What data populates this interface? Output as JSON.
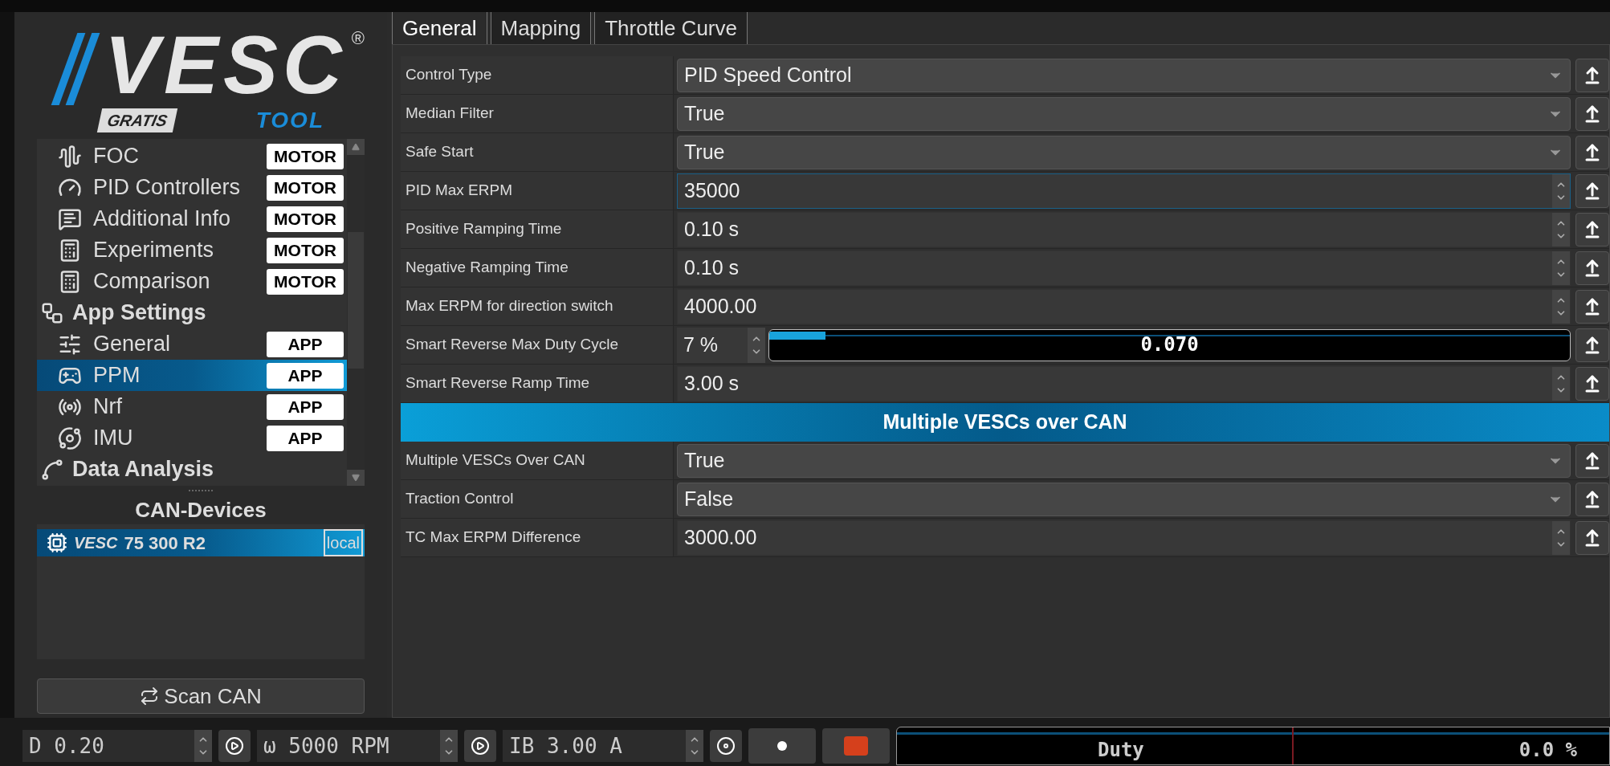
{
  "logo": {
    "wordmark": "VESC",
    "registered": "®",
    "edition": "GRATIS",
    "product": "TOOL"
  },
  "sidebar": {
    "items": [
      {
        "kind": "item",
        "label": "FOC",
        "badge": "MOTOR",
        "selected": false
      },
      {
        "kind": "item",
        "label": "PID Controllers",
        "badge": "MOTOR",
        "selected": false
      },
      {
        "kind": "item",
        "label": "Additional Info",
        "badge": "MOTOR",
        "selected": false
      },
      {
        "kind": "item",
        "label": "Experiments",
        "badge": "MOTOR",
        "selected": false
      },
      {
        "kind": "item",
        "label": "Comparison",
        "badge": "MOTOR",
        "selected": false
      },
      {
        "kind": "section",
        "label": "App Settings"
      },
      {
        "kind": "item",
        "label": "General",
        "badge": "APP",
        "selected": false
      },
      {
        "kind": "item",
        "label": "PPM",
        "badge": "APP",
        "selected": true
      },
      {
        "kind": "item",
        "label": "Nrf",
        "badge": "APP",
        "selected": false
      },
      {
        "kind": "item",
        "label": "IMU",
        "badge": "APP",
        "selected": false
      },
      {
        "kind": "section",
        "label": "Data Analysis"
      }
    ]
  },
  "can_devices": {
    "title": "CAN-Devices",
    "devices": [
      {
        "logo": "VESC",
        "name": "75 300 R2",
        "badge": "local",
        "selected": true
      }
    ],
    "scan_button": "Scan CAN"
  },
  "tabs": [
    {
      "label": "General",
      "selected": true
    },
    {
      "label": "Mapping",
      "selected": false
    },
    {
      "label": "Throttle Curve",
      "selected": false
    }
  ],
  "rows": [
    {
      "kind": "combo",
      "label": "Control Type",
      "value": "PID Speed Control"
    },
    {
      "kind": "combo",
      "label": "Median Filter",
      "value": "True"
    },
    {
      "kind": "combo",
      "label": "Safe Start",
      "value": "True"
    },
    {
      "kind": "spin",
      "label": "PID Max ERPM",
      "value": "35000",
      "focused": true
    },
    {
      "kind": "spin",
      "label": "Positive Ramping Time",
      "value": "0.10 s",
      "focused": false
    },
    {
      "kind": "spin",
      "label": "Negative Ramping Time",
      "value": "0.10 s",
      "focused": false
    },
    {
      "kind": "spin",
      "label": "Max ERPM for direction switch",
      "value": "4000.00",
      "focused": false
    },
    {
      "kind": "slider",
      "label": "Smart Reverse Max Duty Cycle",
      "value": "7 %",
      "level": 0.07,
      "reading": "0.070"
    },
    {
      "kind": "spin",
      "label": "Smart Reverse Ramp Time",
      "value": "3.00 s",
      "focused": false
    },
    {
      "kind": "header",
      "label": "Multiple VESCs over CAN"
    },
    {
      "kind": "combo",
      "label": "Multiple VESCs Over CAN",
      "value": "True"
    },
    {
      "kind": "combo",
      "label": "Traction Control",
      "value": "False"
    },
    {
      "kind": "spin",
      "label": "TC Max ERPM Difference",
      "value": "3000.00",
      "focused": false
    }
  ],
  "bottom_bar": {
    "duty_field": "D 0.20",
    "speed_field": "ω 5000 RPM",
    "current_field": "IB 3.00 A",
    "gauge": {
      "label": "Duty",
      "reading": "0.0 %"
    }
  }
}
